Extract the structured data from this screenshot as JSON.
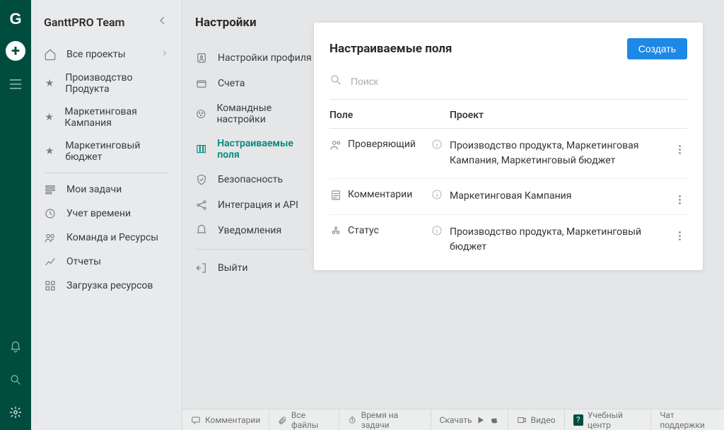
{
  "header": {
    "team_name": "GanttPRO Team"
  },
  "sidebar": {
    "all_projects": "Все проекты",
    "projects": [
      "Производство Продукта",
      "Маркетинговая Кампания",
      "Маркетинговый бюджет"
    ],
    "my_tasks": "Мои задачи",
    "time_tracking": "Учет времени",
    "team_resources": "Команда и Ресурсы",
    "reports": "Отчеты",
    "workload": "Загрузка ресурсов"
  },
  "settings": {
    "heading": "Настройки",
    "items": {
      "profile": "Настройки профиля",
      "billing": "Счета",
      "team": "Командные настройки",
      "custom_fields": "Настраиваемые поля",
      "security": "Безопасность",
      "integration": "Интеграция и API",
      "notifications": "Уведомления",
      "logout": "Выйти"
    }
  },
  "panel": {
    "title": "Настраиваемые поля",
    "create_btn": "Создать",
    "search_placeholder": "Поиск",
    "col_field": "Поле",
    "col_project": "Проект",
    "rows": [
      {
        "name": "Проверяющий",
        "projects": "Производство продукта, Маркетинговая Кампания, Маркетинговый бюджет"
      },
      {
        "name": "Комментарии",
        "projects": "Маркетинговая Кампания"
      },
      {
        "name": "Статус",
        "projects": "Производство продукта, Маркетинговый бюджет"
      }
    ]
  },
  "bottombar": {
    "comments": "Комментарии",
    "files": "Все файлы",
    "time": "Время на задачи",
    "download": "Скачать",
    "video": "Видео",
    "help": "Учебный центр",
    "chat": "Чат поддержки"
  }
}
